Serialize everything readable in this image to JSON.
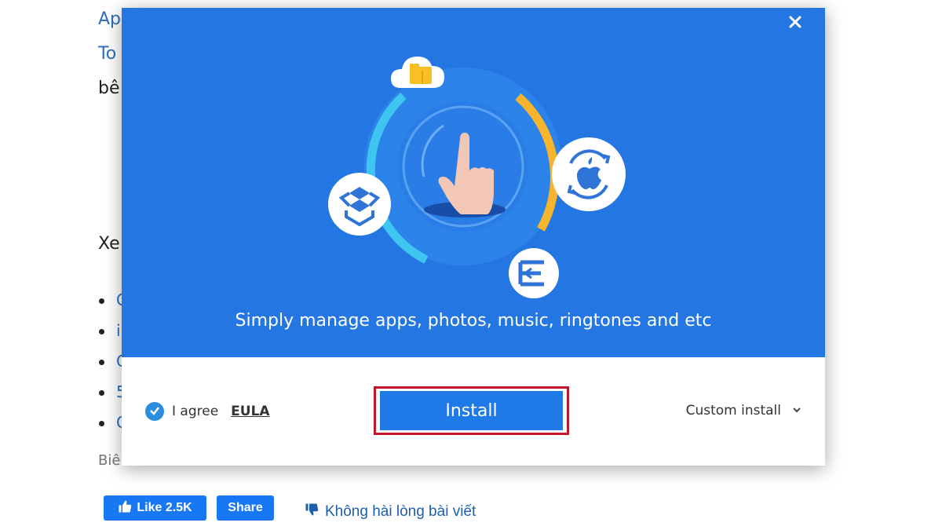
{
  "article": {
    "line1": "Ap",
    "line2": "To",
    "line3": "bê",
    "line4": "Xe",
    "bullet_fragments": [
      "C",
      "i",
      "C",
      "5",
      "C"
    ],
    "caption": "Biê"
  },
  "social": {
    "like_label": "Like 2.5K",
    "share_label": "Share",
    "dislike_label": "Không hài lòng bài viết"
  },
  "dialog": {
    "tagline": "Simply manage apps, photos, music, ringtones and etc",
    "agree_label": "I agree",
    "eula_label": "EULA",
    "install_label": "Install",
    "custom_install_label": "Custom install",
    "colors": {
      "hero": "#2477e2",
      "install": "#1f7ae8",
      "highlight": "#c0172e",
      "arc_cyan": "#3ec6f0",
      "arc_orange": "#f6b52c"
    },
    "icons": [
      "close-icon",
      "cloud-folder-icon",
      "pointing-hand-icon",
      "apple-sync-icon",
      "dropbox-icon",
      "eu-app-icon",
      "check-icon",
      "chevron-down-icon"
    ]
  }
}
